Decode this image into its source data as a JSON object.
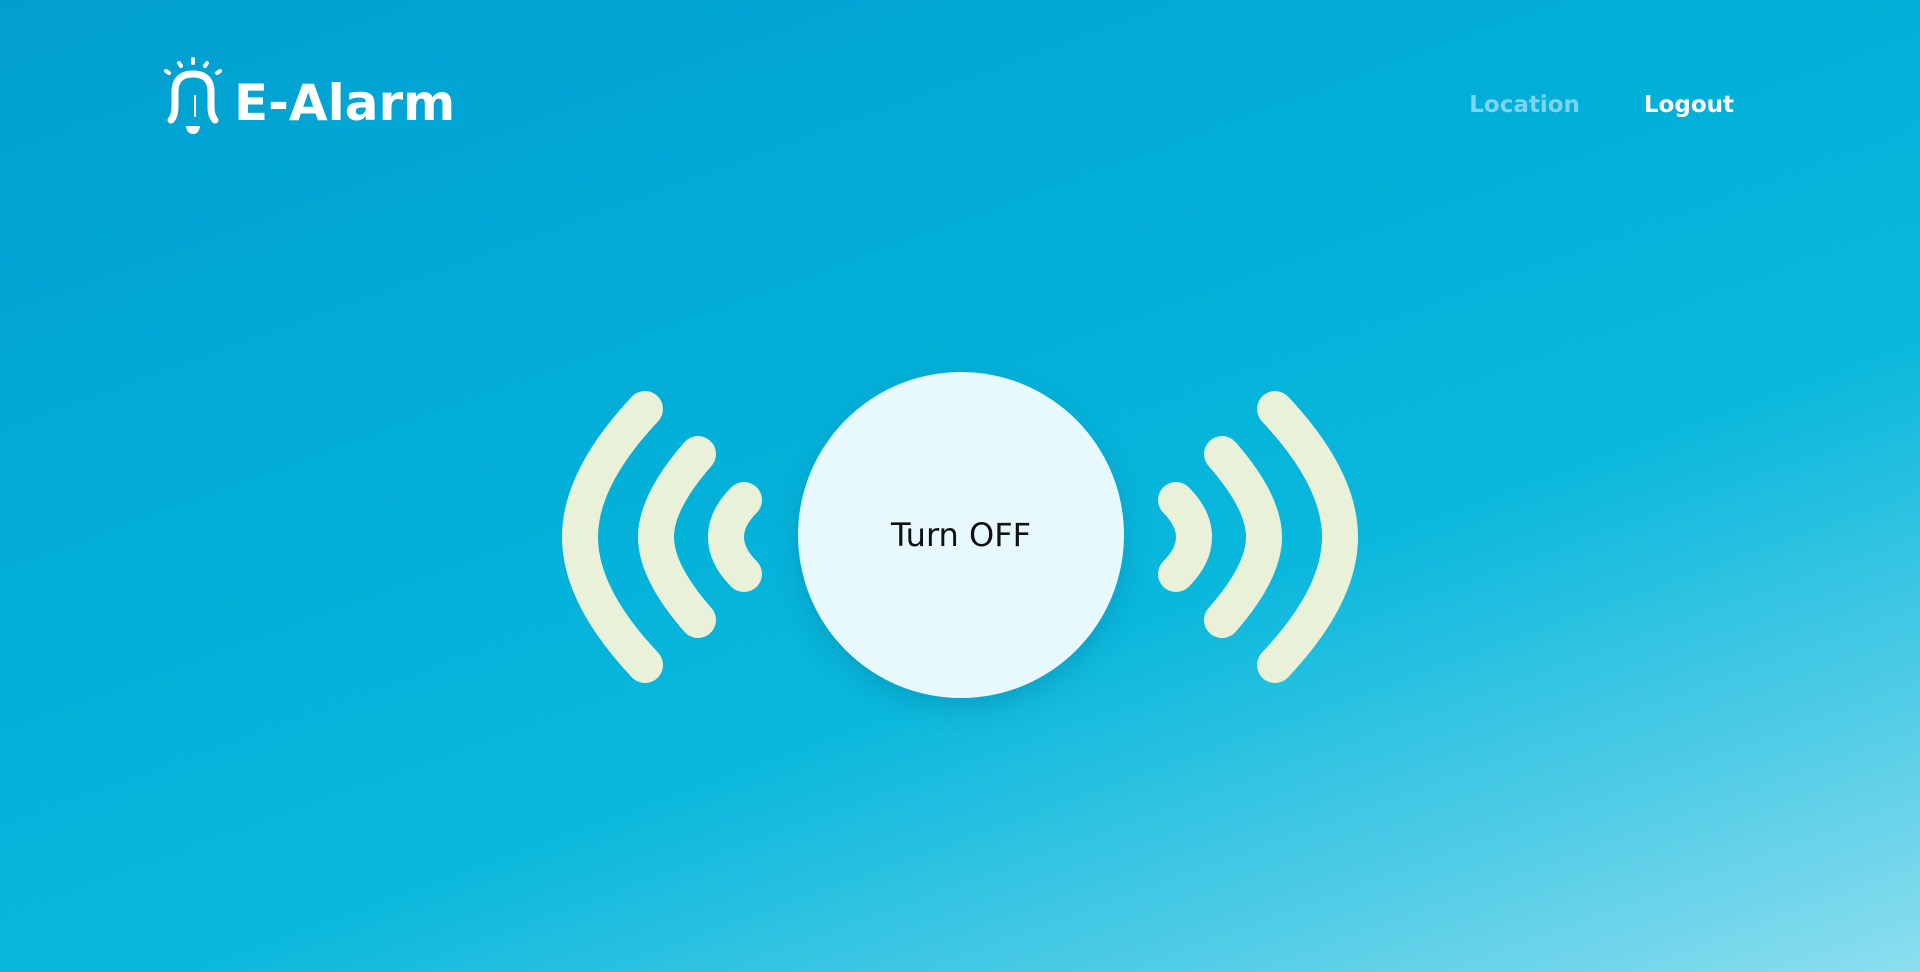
{
  "header": {
    "app_name": "E-Alarm",
    "logo_icon": "bell-icon",
    "nav": {
      "location_label": "Location",
      "logout_label": "Logout"
    }
  },
  "main": {
    "button_label": "Turn OFF",
    "wave_icon": "signal-waves-icon"
  },
  "colors": {
    "background_start": "#019fd0",
    "background_end": "#8cdeef",
    "button_fill": "#e8f9fd",
    "waves": "#e9f2d9",
    "nav_location": "#7ed4ee",
    "nav_logout": "#ffffff"
  }
}
